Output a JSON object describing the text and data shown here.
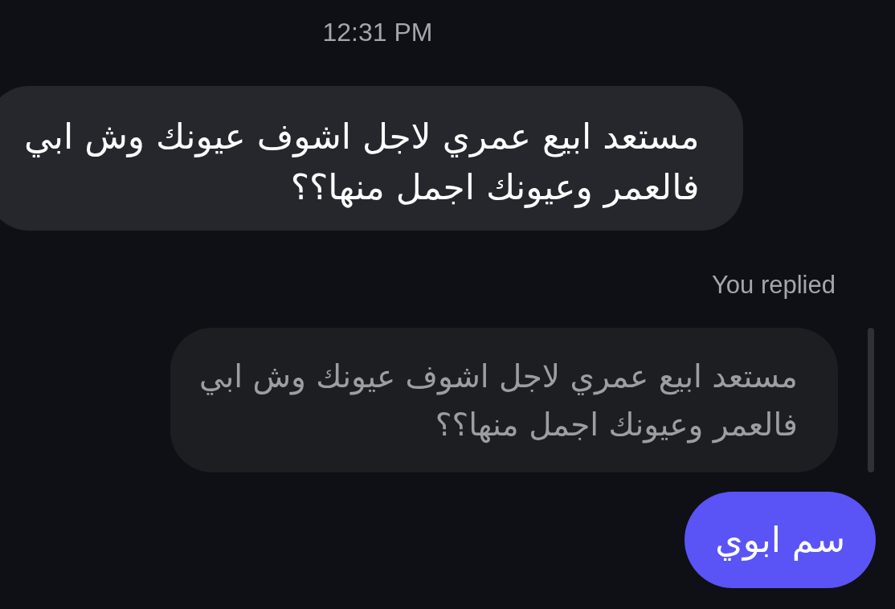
{
  "timestamp": "12:31 PM",
  "incoming_message": {
    "text": "مستعد ابيع عمري لاجل اشوف عيونك وش ابي\nفالعمر وعيونك اجمل منها؟؟"
  },
  "reply": {
    "label": "You replied",
    "quoted_text": "مستعد ابيع عمري لاجل اشوف عيونك وش ابي\nفالعمر وعيونك اجمل منها؟؟",
    "text": "سم ابوي"
  }
}
